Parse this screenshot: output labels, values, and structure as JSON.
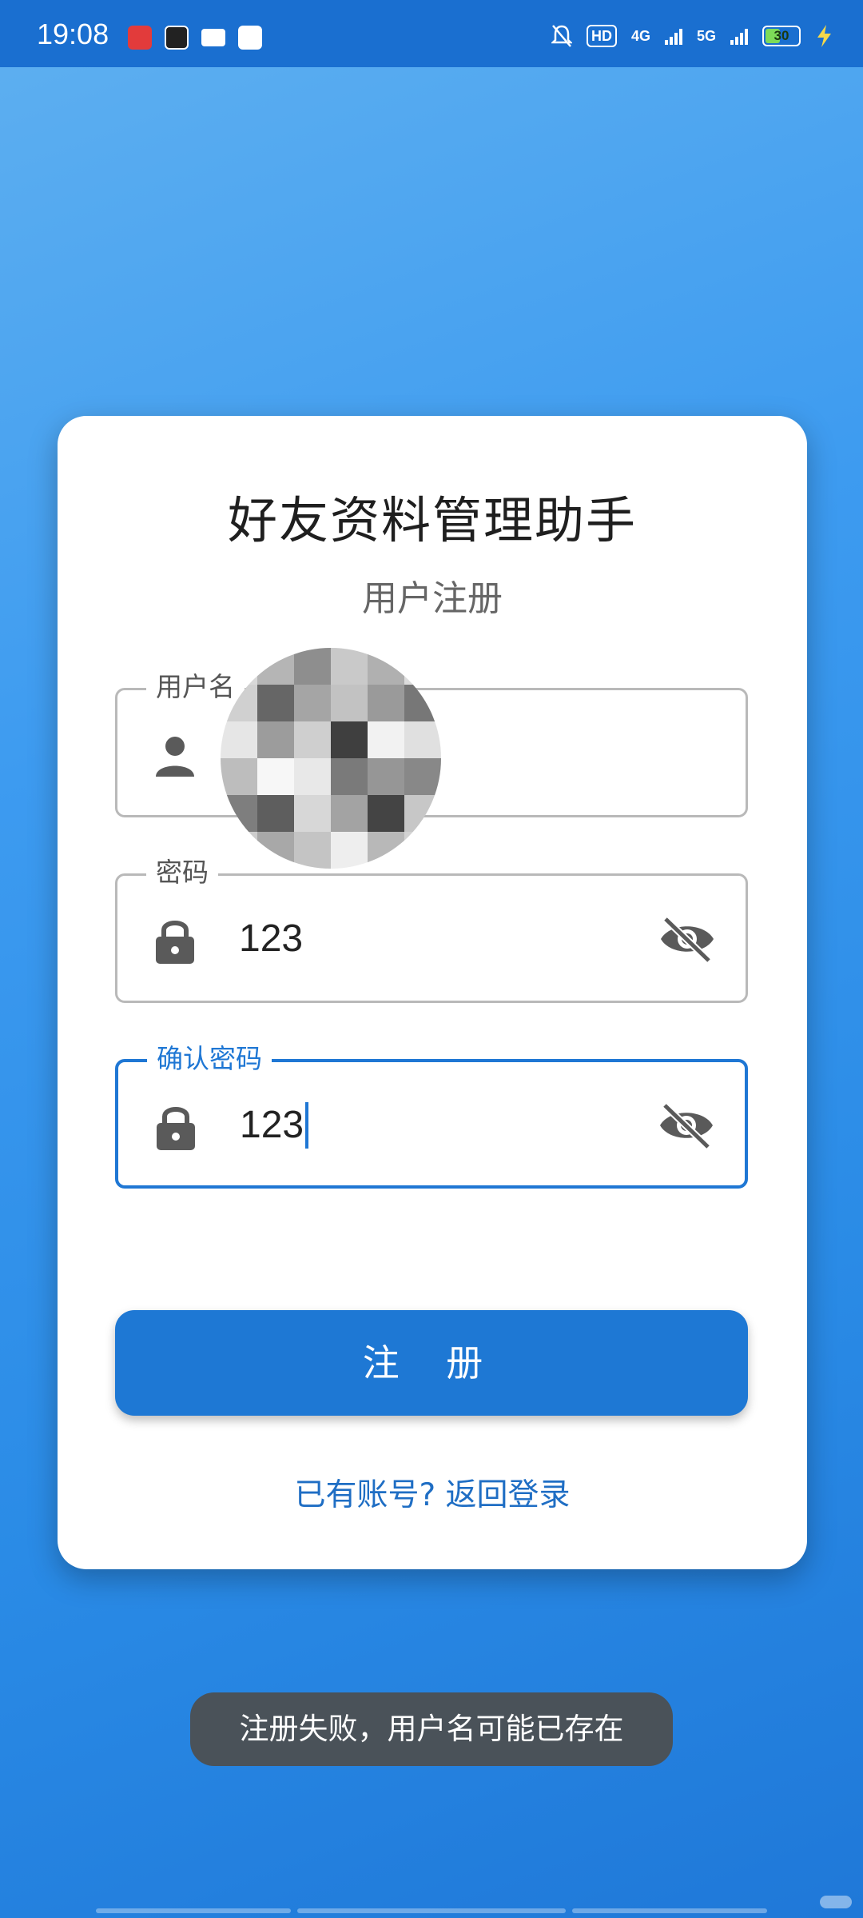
{
  "status_bar": {
    "time": "19:08",
    "network_hd": "HD",
    "network_4g": "4G",
    "network_5g": "5G",
    "battery": "30"
  },
  "app": {
    "title": "好友资料管理助手",
    "subtitle": "用户注册"
  },
  "form": {
    "username": {
      "label": "用户名",
      "value": ""
    },
    "password": {
      "label": "密码",
      "value": "123"
    },
    "confirm_password": {
      "label": "确认密码",
      "value": "123"
    }
  },
  "register_button": {
    "label": "注 册"
  },
  "login_link": {
    "label": "已有账号? 返回登录"
  },
  "toast": {
    "message": "注册失败，用户名可能已存在"
  },
  "colors": {
    "primary": "#1e78d4",
    "background": "#3d9bf0",
    "toast": "#4a5259"
  }
}
